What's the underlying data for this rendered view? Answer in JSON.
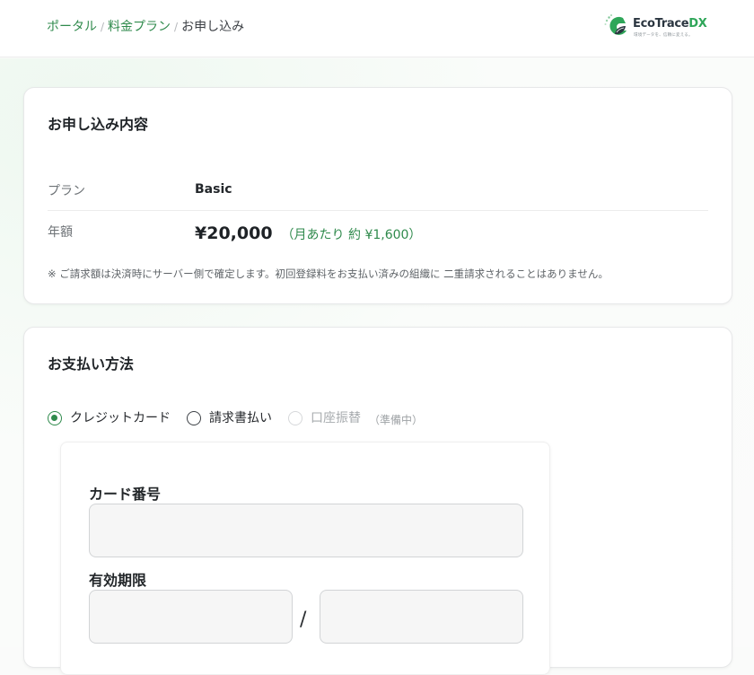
{
  "breadcrumb": {
    "items": [
      {
        "label": "ポータル"
      },
      {
        "label": "料金プラン"
      }
    ],
    "current": "お申し込み",
    "separator": "/"
  },
  "brand": {
    "name_part1": "EcoTrace",
    "name_part2": "DX",
    "tagline": "環境データを、信頼に変える。",
    "logo_icon": "leaf-globe-icon",
    "colors": {
      "green": "#2fa659",
      "dark": "#2b3640"
    }
  },
  "summary": {
    "title": "お申し込み内容",
    "plan_label": "プラン",
    "plan_value": "Basic",
    "amount_label": "年額",
    "amount_value": "¥20,000",
    "amount_monthly": "（月あたり 約 ¥1,600）",
    "note": "※ ご請求額は決済時にサーバー側で確定します。初回登録料をお支払い済みの組織に 二重請求されることはありません。"
  },
  "payment": {
    "title": "お支払い方法",
    "methods": [
      {
        "label": "クレジットカード",
        "selected": true,
        "disabled": false
      },
      {
        "label": "請求書払い",
        "selected": false,
        "disabled": false
      },
      {
        "label": "口座振替",
        "selected": false,
        "disabled": true,
        "note": "（準備中）"
      }
    ],
    "card_number_label": "カード番号",
    "card_number_value": "",
    "expiry_label": "有効期限",
    "expiry_month_value": "",
    "expiry_year_value": "",
    "expiry_separator": "/"
  },
  "colors": {
    "accent": "#2f8a4c",
    "border": "#e7e8e9"
  }
}
